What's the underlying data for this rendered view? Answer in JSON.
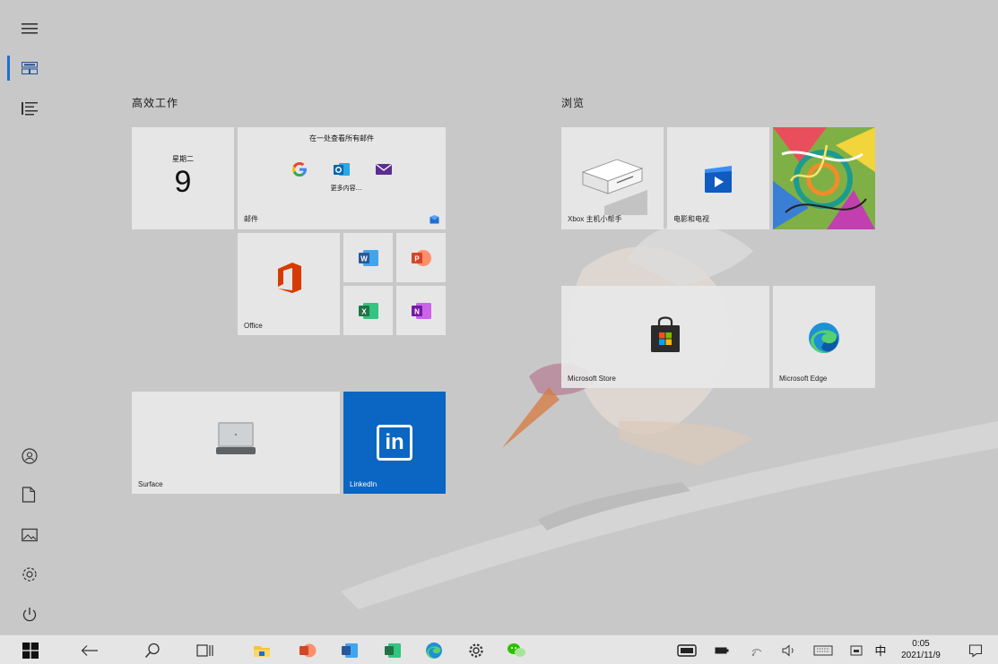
{
  "rail": {
    "items": [
      {
        "name": "expand",
        "icon": "hamburger-icon"
      },
      {
        "name": "pinned-tiles",
        "icon": "tiles-icon",
        "active": true
      },
      {
        "name": "all-apps",
        "icon": "list-icon"
      },
      {
        "name": "account",
        "icon": "user-icon"
      },
      {
        "name": "documents",
        "icon": "document-icon"
      },
      {
        "name": "pictures",
        "icon": "pictures-icon"
      },
      {
        "name": "settings",
        "icon": "gear-icon"
      },
      {
        "name": "power",
        "icon": "power-icon"
      }
    ]
  },
  "groups": {
    "productivity": {
      "title": "高效工作"
    },
    "explore": {
      "title": "浏览"
    }
  },
  "tiles": {
    "calendar": {
      "weekday": "星期二",
      "day": "9"
    },
    "mail": {
      "header": "在一处查看所有邮件",
      "more": "更多内容...",
      "label": "邮件"
    },
    "office": {
      "label": "Office"
    },
    "xbox": {
      "label": "Xbox 主机小帮手"
    },
    "movies": {
      "label": "电影和电视"
    },
    "store": {
      "label": "Microsoft Store"
    },
    "edge": {
      "label": "Microsoft Edge"
    },
    "surface": {
      "label": "Surface"
    },
    "linkedin": {
      "label": "LinkedIn",
      "logo": "in"
    }
  },
  "taskbar": {
    "ime": "中",
    "time": "0:05",
    "date": "2021/11/9"
  },
  "colors": {
    "accent": "#1f6fd1",
    "linkedin": "#0a66c2",
    "office": "#d83b01",
    "word": "#2b579a",
    "excel": "#217346",
    "powerpoint": "#d24726",
    "onenote": "#7719aa"
  }
}
